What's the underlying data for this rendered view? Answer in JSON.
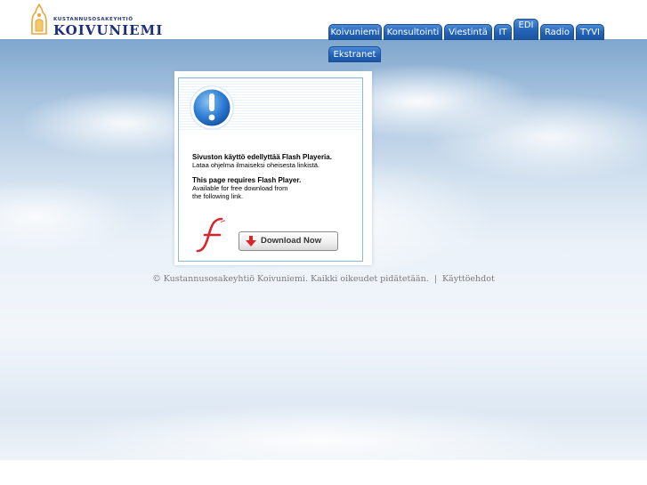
{
  "logo": {
    "company_small": "KUSTANNUSOSAKEYHTIÖ",
    "company_big": "KOIVUNIEMI"
  },
  "nav": {
    "tabs": [
      {
        "label": "Koivuniemi",
        "active": false
      },
      {
        "label": "Konsultointi",
        "active": false
      },
      {
        "label": "Viestintä",
        "active": false
      },
      {
        "label": "IT",
        "active": false
      },
      {
        "label": "EDI",
        "active": true
      },
      {
        "label": "Radio",
        "active": false
      },
      {
        "label": "TYVI",
        "active": false
      },
      {
        "label": "Ekstranet",
        "active": false
      }
    ]
  },
  "flash_notice": {
    "fi_heading": "Sivuston käyttö edellyttää Flash Playeria.",
    "fi_text": "Lataa ohjelma ilmaiseksi oheisesta linkistä.",
    "en_heading": "This page requires Flash Player.",
    "en_text_line1": "Available for free download from",
    "en_text_line2": "the following link.",
    "download_label": "Download Now"
  },
  "footer": {
    "copyright": "© Kustannusosakeyhtiö Koivuniemi. Kaikki oikeudet pidätetään.",
    "separator": "|",
    "terms_link": "Käyttöehdot"
  },
  "colors": {
    "tab_blue": "#2464b8",
    "logo_blue": "#1c2f7c",
    "logo_orange": "#e8a53a",
    "flash_red": "#d9262b",
    "border_blue": "#8fb6df"
  }
}
